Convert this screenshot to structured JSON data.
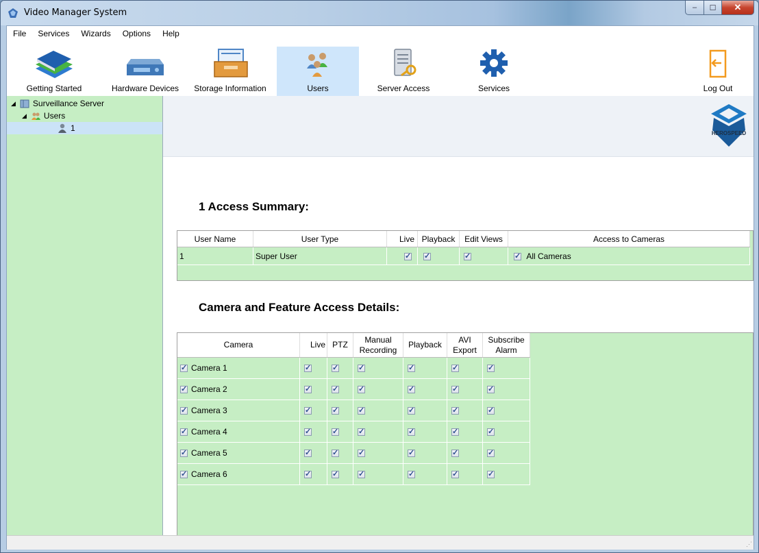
{
  "window": {
    "title": "Video Manager System",
    "min": "–",
    "max": "☐",
    "close": "✕"
  },
  "menu": [
    "File",
    "Services",
    "Wizards",
    "Options",
    "Help"
  ],
  "toolbar": {
    "getting_started": "Getting Started",
    "hardware_devices": "Hardware Devices",
    "storage_information": "Storage Information",
    "users": "Users",
    "server_access": "Server Access",
    "services": "Services",
    "log_out": "Log Out"
  },
  "tree": {
    "server": "Surveillance Server",
    "users": "Users",
    "user1": "1"
  },
  "logo_text": "HEROSPEED",
  "summary": {
    "title": "1 Access Summary:",
    "headers": [
      "User Name",
      "User Type",
      "Live",
      "Playback",
      "Edit Views",
      "Access to Cameras"
    ],
    "row": {
      "user_name": "1",
      "user_type": "Super User",
      "all_cameras": "All Cameras"
    }
  },
  "details": {
    "title": "Camera and Feature Access Details:",
    "headers": {
      "camera": "Camera",
      "live": "Live",
      "ptz": "PTZ",
      "manual1": "Manual",
      "manual2": "Recording",
      "playback": "Playback",
      "avi1": "AVI",
      "avi2": "Export",
      "sub1": "Subscribe",
      "sub2": "Alarm"
    },
    "cameras": [
      "Camera 1",
      "Camera 2",
      "Camera 3",
      "Camera 4",
      "Camera 5",
      "Camera 6"
    ]
  },
  "colors": {
    "panel_green": "#c6eec4",
    "selection": "#cfe6fb"
  }
}
